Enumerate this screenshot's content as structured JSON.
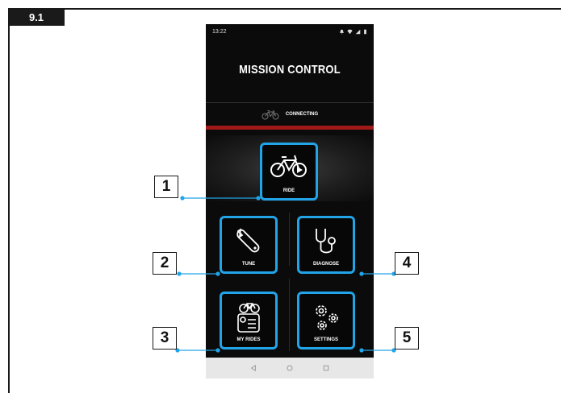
{
  "figure": {
    "label": "9.1"
  },
  "status_bar": {
    "time": "13:22"
  },
  "app": {
    "title": "MISSION CONTROL",
    "connection_status": "CONNECTING",
    "accent_color": "#22a4e8",
    "bar_color": "#a01818"
  },
  "tiles": {
    "ride": "RIDE",
    "tune": "TUNE",
    "diagnose": "DIAGNOSE",
    "my_rides": "MY RIDES",
    "settings": "SETTINGS"
  },
  "callouts": [
    "1",
    "2",
    "3",
    "4",
    "5"
  ],
  "nav": [
    "back-icon",
    "home-icon",
    "recents-icon"
  ]
}
